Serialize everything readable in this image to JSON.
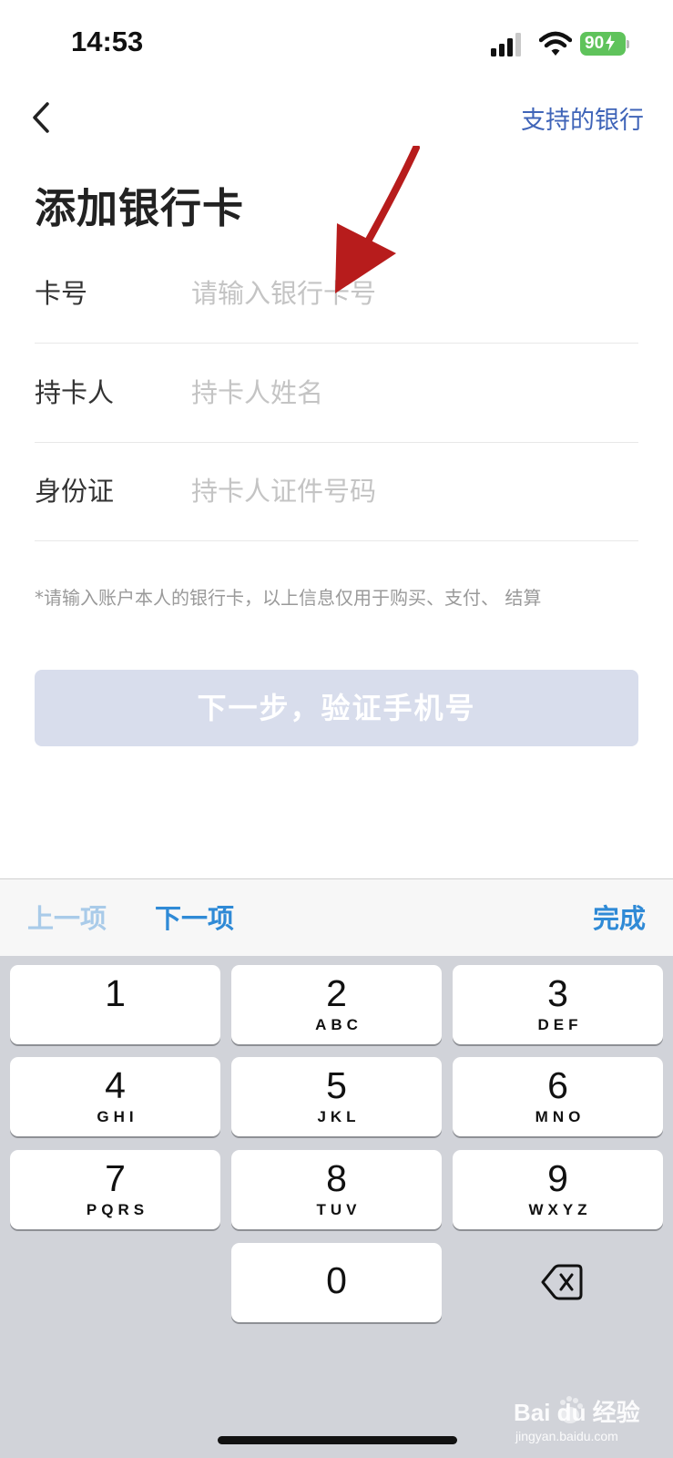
{
  "status_bar": {
    "time": "14:53",
    "battery": "90"
  },
  "nav": {
    "support_link": "支持的银行"
  },
  "page": {
    "title": "添加银行卡"
  },
  "form": {
    "rows": [
      {
        "label": "卡号",
        "placeholder": "请输入银行卡号",
        "value": ""
      },
      {
        "label": "持卡人",
        "placeholder": "持卡人姓名",
        "value": ""
      },
      {
        "label": "身份证",
        "placeholder": "持卡人证件号码",
        "value": ""
      }
    ],
    "notice": "*请输入账户本人的银行卡，以上信息仅用于购买、支付、 结算",
    "next_button": "下一步，验证手机号"
  },
  "accessory_bar": {
    "prev": "上一项",
    "next": "下一项",
    "done": "完成"
  },
  "keypad": {
    "keys": [
      {
        "digit": "1",
        "letters": ""
      },
      {
        "digit": "2",
        "letters": "ABC"
      },
      {
        "digit": "3",
        "letters": "DEF"
      },
      {
        "digit": "4",
        "letters": "GHI"
      },
      {
        "digit": "5",
        "letters": "JKL"
      },
      {
        "digit": "6",
        "letters": "MNO"
      },
      {
        "digit": "7",
        "letters": "PQRS"
      },
      {
        "digit": "8",
        "letters": "TUV"
      },
      {
        "digit": "9",
        "letters": "WXYZ"
      },
      {
        "digit": "0",
        "letters": ""
      }
    ]
  },
  "watermark": {
    "logo_text": "Bai du 经验",
    "url": "jingyan.baidu.com"
  },
  "colors": {
    "link_blue": "#3f64b8",
    "accessory_blue": "#2f8ad6",
    "disabled_button": "#d8ddec",
    "battery_green": "#5fc35b",
    "annotation_red": "#b71c1c"
  }
}
